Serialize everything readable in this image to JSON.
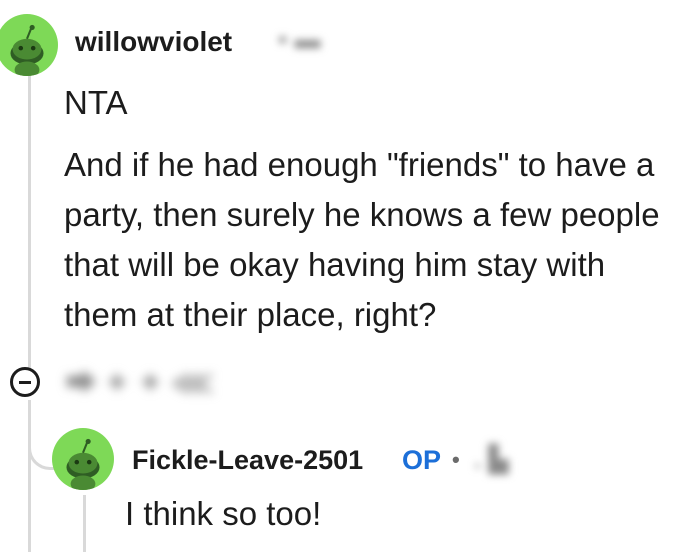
{
  "comment": {
    "author": "willowviolet",
    "lines": [
      "NTA",
      "And if he had enough \"friends\" to have a",
      "party, then surely he knows a few people",
      "that will be okay having him stay with",
      "them at their place, right?"
    ]
  },
  "reply": {
    "author": "Fickle-Leave-2501",
    "op_badge": "OP",
    "separator": "•",
    "text": "I think so too!"
  },
  "colors": {
    "avatar": "#7ed957",
    "op_badge": "#1c6fd8",
    "thread_line": "#d9d9d9"
  },
  "icons": {
    "avatar": "snoo-avatar-icon",
    "collapse": "collapse-thread-icon"
  }
}
